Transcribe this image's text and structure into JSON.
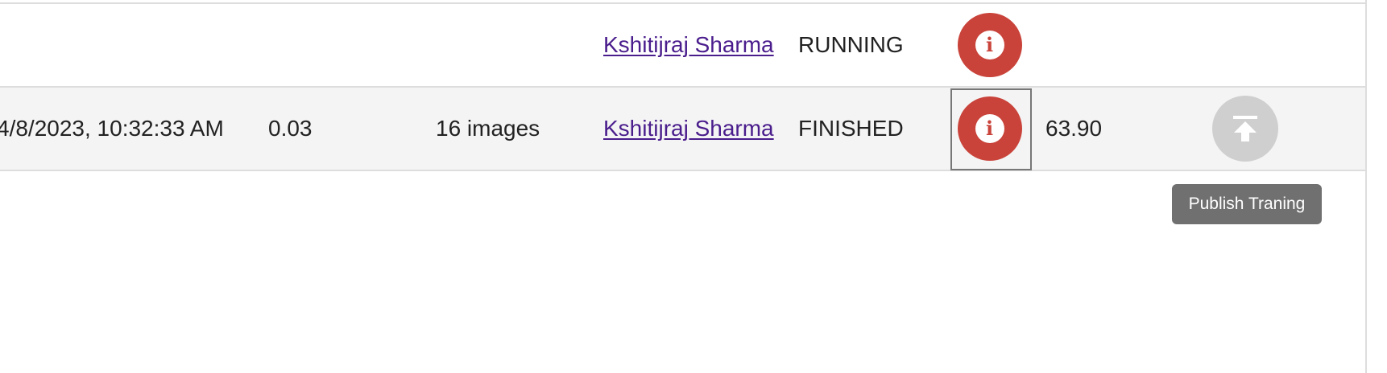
{
  "rows": [
    {
      "date": "",
      "loss": "",
      "images": "",
      "user": "Kshitijraj Sharma",
      "status": "RUNNING",
      "score": ""
    },
    {
      "date": "4/8/2023, 10:32:33 AM",
      "loss": "0.03",
      "images": "16 images",
      "user": "Kshitijraj Sharma",
      "status": "FINISHED",
      "score": "63.90"
    }
  ],
  "tooltip": {
    "text": "Publish Traning"
  },
  "icons": {
    "info": "info-icon",
    "publish": "publish-upload-icon"
  },
  "colors": {
    "info_button": "#c9433a",
    "publish_button_disabled": "#cfcfcf",
    "link": "#4a1d8c",
    "tooltip_bg": "#707070",
    "row_alt_bg": "#f4f4f4"
  }
}
